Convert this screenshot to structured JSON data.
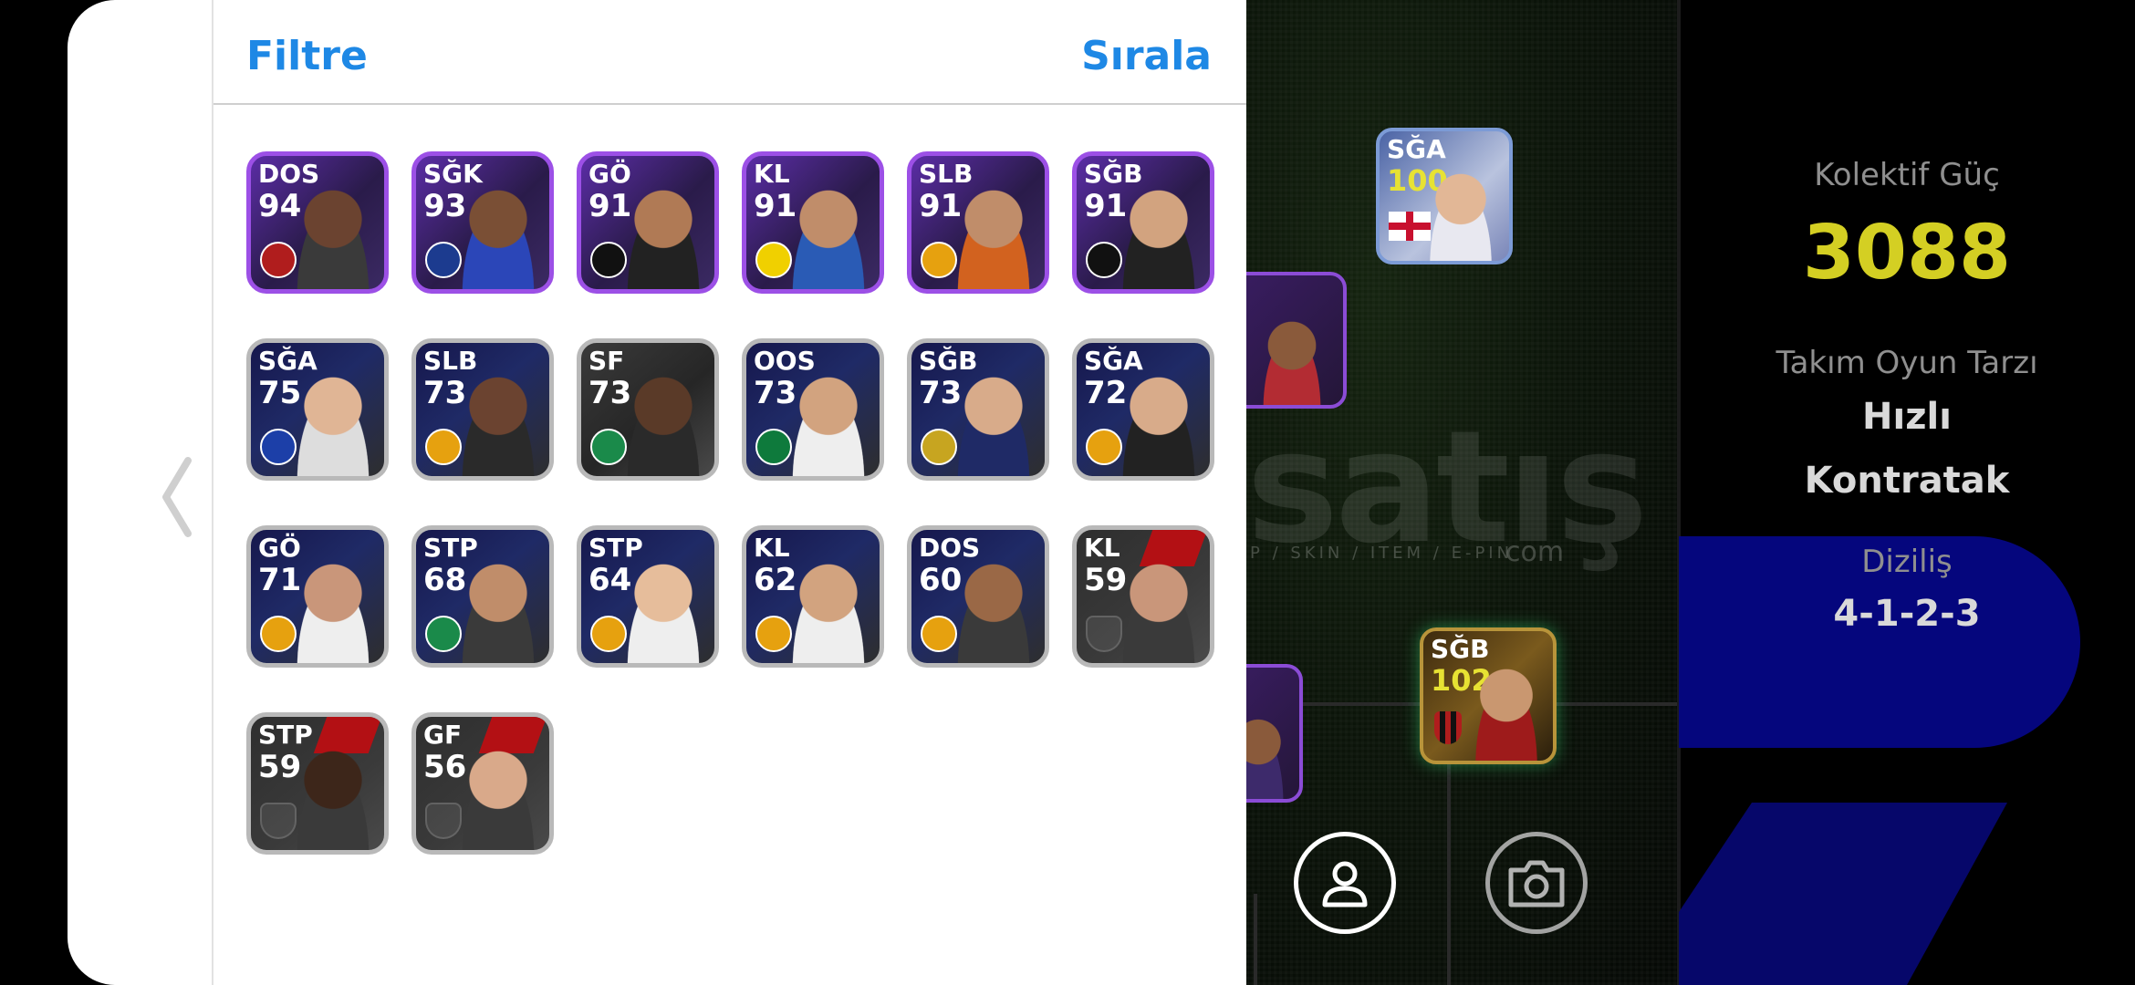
{
  "header": {
    "filter_label": "Filtre",
    "sort_label": "Sırala"
  },
  "players": [
    {
      "pos": "DOS",
      "ovr": "94"
    },
    {
      "pos": "SĞK",
      "ovr": "93"
    },
    {
      "pos": "GÖ",
      "ovr": "91"
    },
    {
      "pos": "KL",
      "ovr": "91"
    },
    {
      "pos": "SLB",
      "ovr": "91"
    },
    {
      "pos": "SĞB",
      "ovr": "91"
    },
    {
      "pos": "SĞA",
      "ovr": "75"
    },
    {
      "pos": "SLB",
      "ovr": "73"
    },
    {
      "pos": "SF",
      "ovr": "73"
    },
    {
      "pos": "OOS",
      "ovr": "73"
    },
    {
      "pos": "SĞB",
      "ovr": "73"
    },
    {
      "pos": "SĞA",
      "ovr": "72"
    },
    {
      "pos": "GÖ",
      "ovr": "71"
    },
    {
      "pos": "STP",
      "ovr": "68"
    },
    {
      "pos": "STP",
      "ovr": "64"
    },
    {
      "pos": "KL",
      "ovr": "62"
    },
    {
      "pos": "DOS",
      "ovr": "60"
    },
    {
      "pos": "KL",
      "ovr": "59"
    },
    {
      "pos": "STP",
      "ovr": "59"
    },
    {
      "pos": "GF",
      "ovr": "56"
    }
  ],
  "pitch_cards": [
    {
      "pos": "SĞA",
      "ovr": "100"
    },
    {
      "pos": "SĞB",
      "ovr": "102"
    }
  ],
  "stats": {
    "power_label": "Kolektif Güç",
    "power_value": "3088",
    "style_label": "Takım Oyun Tarzı",
    "style_value_1": "Hızlı",
    "style_value_2": "Kontratak",
    "formation_label": "Diziliş",
    "formation_value": "4-1-2-3"
  },
  "watermark": {
    "main": "satış",
    "sub": "P / SKIN / ITEM / E-PIN",
    "domain": "com"
  },
  "colors": {
    "accent_blue": "#1e88e5",
    "power_yellow": "#d4cf23",
    "epic_purple": "#9c50e6",
    "formation_blue": "#05067d"
  },
  "icons": {
    "back": "chevron-left-icon",
    "profile": "user-icon",
    "camera": "camera-icon"
  }
}
